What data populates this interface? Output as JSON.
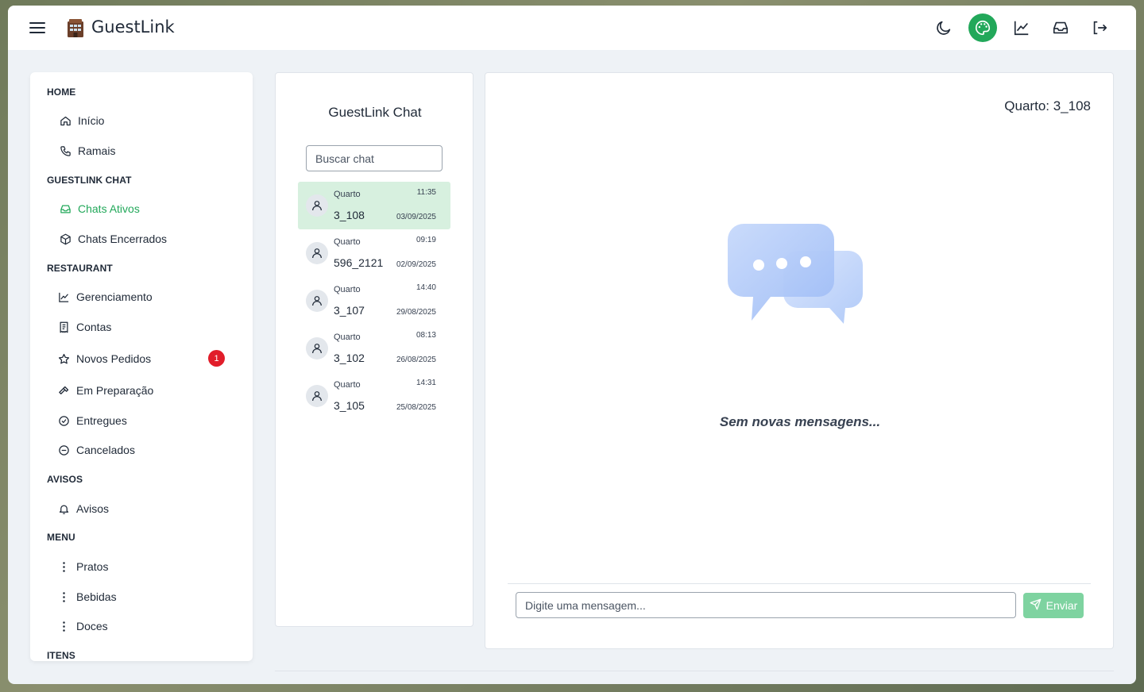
{
  "app": {
    "title": "GuestLink"
  },
  "topbar": {
    "icons": [
      "menu-icon",
      "moon-icon",
      "palette-icon",
      "chart-line-icon",
      "inbox-icon",
      "logout-icon"
    ],
    "active_color": "#22a85a"
  },
  "sidebar": {
    "sections": {
      "home": "HOME",
      "chat": "GUESTLINK CHAT",
      "restaurant": "RESTAURANT",
      "avisos": "AVISOS",
      "menu": "MENU",
      "itens": "ITENS"
    },
    "items": {
      "inicio": "Início",
      "ramais": "Ramais",
      "chats_ativos": "Chats Ativos",
      "chats_encerrados": "Chats Encerrados",
      "gerenciamento": "Gerenciamento",
      "contas": "Contas",
      "novos_pedidos": "Novos Pedidos",
      "em_preparacao": "Em Preparação",
      "entregues": "Entregues",
      "cancelados": "Cancelados",
      "avisos": "Avisos",
      "pratos": "Pratos",
      "bebidas": "Bebidas",
      "doces": "Doces"
    },
    "novos_pedidos_badge": "1",
    "badge_color": "#e11d2a"
  },
  "chatlist": {
    "title": "GuestLink Chat",
    "search_placeholder": "Buscar chat",
    "chats": [
      {
        "label": "Quarto",
        "room": "3_108",
        "time": "11:35",
        "date": "03/09/2025"
      },
      {
        "label": "Quarto",
        "room": "596_2121",
        "time": "09:19",
        "date": "02/09/2025"
      },
      {
        "label": "Quarto",
        "room": "3_107",
        "time": "14:40",
        "date": "29/08/2025"
      },
      {
        "label": "Quarto",
        "room": "3_102",
        "time": "08:13",
        "date": "26/08/2025"
      },
      {
        "label": "Quarto",
        "room": "3_105",
        "time": "14:31",
        "date": "25/08/2025"
      }
    ]
  },
  "chatpane": {
    "room_header": "Quarto: 3_108",
    "empty_message": "Sem novas mensagens...",
    "message_placeholder": "Digite uma mensagem...",
    "send_label": "Enviar"
  }
}
